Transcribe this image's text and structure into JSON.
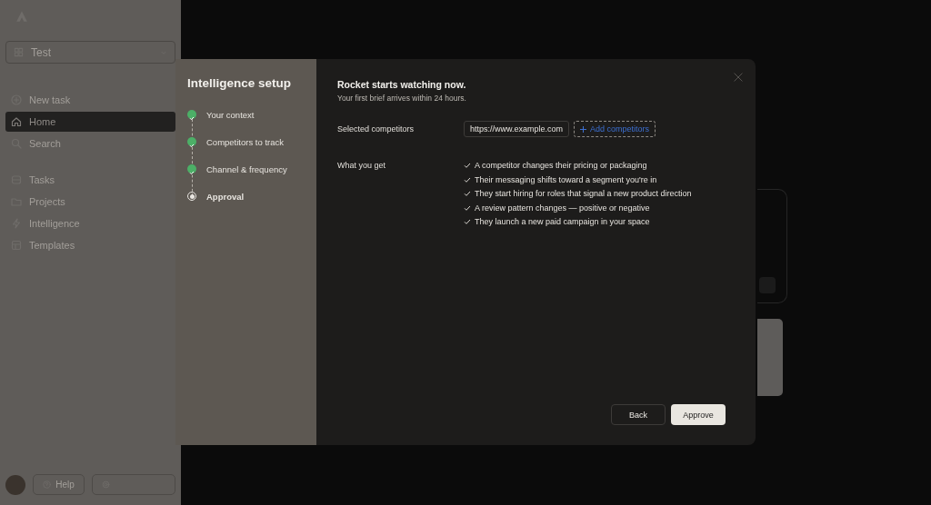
{
  "sidebar": {
    "workspace": "Test",
    "nav": [
      {
        "label": "New task",
        "selected": false
      },
      {
        "label": "Home",
        "selected": true
      },
      {
        "label": "Search",
        "selected": false
      }
    ],
    "sections": [
      {
        "label": "Tasks",
        "selected": false
      },
      {
        "label": "Projects",
        "selected": false
      },
      {
        "label": "Intelligence",
        "selected": false
      },
      {
        "label": "Templates",
        "selected": false
      }
    ],
    "help_button": "Help"
  },
  "modal": {
    "title": "Intelligence setup",
    "steps": [
      {
        "label": "Your context",
        "completed": true,
        "selected": false
      },
      {
        "label": "Competitors to track",
        "completed": true,
        "selected": false
      },
      {
        "label": "Channel & frequency",
        "completed": true,
        "selected": false
      },
      {
        "label": "Approval",
        "completed": false,
        "selected": true
      }
    ],
    "heading": "Rocket starts watching now.",
    "subheading": "Your first brief arrives within 24 hours.",
    "competitors": {
      "label": "Selected competitors",
      "items": [
        "https://www.example.com"
      ],
      "add_button": "Add competitors"
    },
    "benefits": {
      "label": "What you get",
      "items": [
        "A competitor changes their pricing or packaging",
        "Their messaging shifts toward a segment you're in",
        "They start hiring for roles that signal a new product direction",
        "A review pattern changes — positive or negative",
        "They launch a new paid campaign in your space"
      ]
    },
    "buttons": {
      "back": "Back",
      "approve": "Approve"
    }
  }
}
